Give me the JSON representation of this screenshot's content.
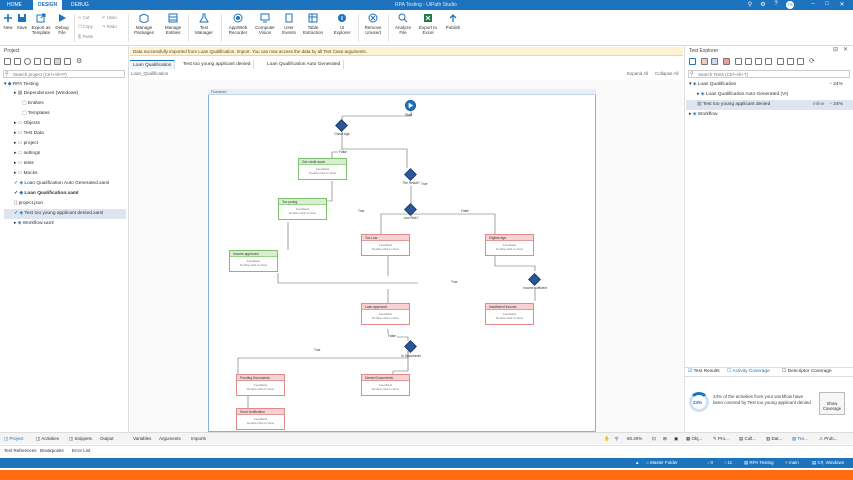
{
  "titlebar": {
    "tabs": [
      "HOME",
      "DESIGN",
      "DEBUG"
    ],
    "active_tab": "DESIGN",
    "title": "RPA Testing - UiPath Studio"
  },
  "ribbon": {
    "new": "New",
    "save": "Save",
    "export_template": "Export as Template",
    "debug_file": "Debug File",
    "cut": "Cut",
    "copy": "Copy",
    "paste": "Paste",
    "undo": "Undo",
    "redo": "Redo",
    "manage_packages": "Manage Packages",
    "manage_entities": "Manage Entities",
    "test_manager": "Test Manager",
    "app_web_recorder": "App/Web Recorder",
    "computer_vision": "Computer Vision",
    "user_events": "User Events",
    "table_extraction": "Table Extraction",
    "ui_explorer": "UI Explorer",
    "remove_unused": "Remove Unused",
    "analyze_file": "Analyze File",
    "export_to_excel": "Export to Excel",
    "publish": "Publish"
  },
  "notification": "Data successfully imported from Loan Qualification. Import. You can now access the data by all Test Case arguments.",
  "project": {
    "title": "Project",
    "search_placeholder": "Search project (Ctrl+Alt+P)",
    "root": "RPA Testing",
    "items": [
      "Dependencies (Windows)",
      "Entities",
      "Templates",
      "Objects",
      "Test Data",
      "project",
      "settings",
      "tests",
      "Mocks",
      "Loan Qualification Auto Generated.xaml",
      "Loan Qualification.xaml",
      "project.json",
      "Test too young applicant denied.xaml",
      "Workflow.xaml"
    ]
  },
  "doc_tabs": [
    "Loan Qualification",
    "Test too young applicant denied",
    "Loan Qualification Auto Generated"
  ],
  "breadcrumb": "Loan_Qualification",
  "expand_all": "Expand All",
  "collapse_all": "Collapse All",
  "flowchart": {
    "title": "Flowchart",
    "start": "Start",
    "nodes": {
      "credit_score": "Get credit score",
      "too_young": "Too young",
      "low_score": "Too Low",
      "eligible": "Eligible Age",
      "income_approved": "Income approved",
      "loan_approved": "Loan approved",
      "rejected_income": "Insufficient Income",
      "pending": "Pending Documents",
      "denied_docs": "Denied Documents",
      "send_notice": "Send Notification"
    },
    "decisions": {
      "check_age": "Check Age",
      "age_check": "The Result?",
      "low": "Low Risk?",
      "income": "Income sufficient",
      "docs": "In Documents"
    },
    "body_text": "Feedback",
    "body_subtext": "Double-click to View",
    "edges": {
      "true": "True",
      "false": "False"
    }
  },
  "bottom_left_tabs": [
    "Project",
    "Activities",
    "Snippets",
    "Output"
  ],
  "bottom_mid_tabs": [
    "Variables",
    "Arguments",
    "Imports"
  ],
  "zoom": "60.40%",
  "test_refs": [
    "Test References",
    "Breakpoints",
    "Error List"
  ],
  "test_explorer": {
    "title": "Test Explorer",
    "search_placeholder": "Search Tests (Ctrl+Alt+T)",
    "items": [
      {
        "label": "Loan Qualification",
        "pct": "24%"
      },
      {
        "label": "Loan Qualification Auto Generated (VI)",
        "pct": ""
      },
      {
        "label": "Test too young applicant denied",
        "pct": "24%",
        "tag": "Inline"
      },
      {
        "label": "Workflow",
        "pct": ""
      }
    ],
    "tabs": [
      "Test Results",
      "Activity Coverage",
      "Descriptor Coverage"
    ],
    "coverage_pct": "24%",
    "coverage_text": "24% of the activities from your workflow have been covered by Test too young applicant denied",
    "show_coverage": "Show Coverage"
  },
  "right_bottom_tabs": [
    "Obj...",
    "Pro...",
    "Coll...",
    "Dat...",
    "Tes...",
    "Prob..."
  ],
  "status": {
    "left": "",
    "mode": "Master Folder",
    "errors": "0",
    "warnings": "11",
    "project": "RPA Testing",
    "user": "main",
    "target": "C#, Windows"
  },
  "colors": {
    "brand": "#1e73be",
    "accent": "#ff6a13"
  }
}
